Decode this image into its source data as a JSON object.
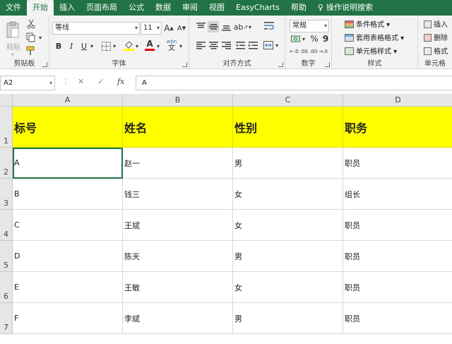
{
  "tabs": [
    {
      "label": "文件",
      "active": false
    },
    {
      "label": "开始",
      "active": true
    },
    {
      "label": "插入",
      "active": false
    },
    {
      "label": "页面布局",
      "active": false
    },
    {
      "label": "公式",
      "active": false
    },
    {
      "label": "数据",
      "active": false
    },
    {
      "label": "审阅",
      "active": false
    },
    {
      "label": "视图",
      "active": false
    },
    {
      "label": "EasyCharts",
      "active": false
    },
    {
      "label": "帮助",
      "active": false
    }
  ],
  "tell_me": "操作说明搜索",
  "ribbon": {
    "clipboard": {
      "paste_label": "粘贴",
      "group_label": "剪贴板"
    },
    "font": {
      "name": "等线",
      "size": "11",
      "grow": "A",
      "shrink": "A",
      "bold": "B",
      "italic": "I",
      "underline": "U",
      "wen": "wén",
      "wen_char": "文",
      "font_color_letter": "A",
      "group_label": "字体"
    },
    "alignment": {
      "group_label": "对齐方式"
    },
    "number": {
      "format": "常规",
      "percent": "%",
      "comma": "9",
      "inc_decimal": "←.0 .00",
      "dec_decimal": ".00 →.0",
      "group_label": "数字"
    },
    "styles": {
      "conditional": "条件格式",
      "table": "套用表格格式",
      "cell": "单元格样式",
      "group_label": "样式"
    },
    "cells": {
      "insert": "插入",
      "delete": "删除",
      "format": "格式",
      "group_label": "单元格"
    }
  },
  "accent": "#217346",
  "header_fill": "#ffff00",
  "formula_bar": {
    "name_box": "A2",
    "cancel": "✕",
    "enter": "✓",
    "fx": "fx",
    "content": "A"
  },
  "columns": [
    "A",
    "B",
    "C",
    "D"
  ],
  "rows": [
    "1",
    "2",
    "3",
    "4",
    "5",
    "6",
    "7"
  ],
  "table": {
    "headers": [
      "标号",
      "姓名",
      "性别",
      "职务"
    ],
    "data": [
      [
        "A",
        "赵一",
        "男",
        "职员"
      ],
      [
        "B",
        "钱三",
        "女",
        "组长"
      ],
      [
        "C",
        "王斌",
        "女",
        "职员"
      ],
      [
        "D",
        "陈天",
        "男",
        "职员"
      ],
      [
        "E",
        "王敏",
        "女",
        "职员"
      ],
      [
        "F",
        "李斌",
        "男",
        "职员"
      ]
    ]
  }
}
